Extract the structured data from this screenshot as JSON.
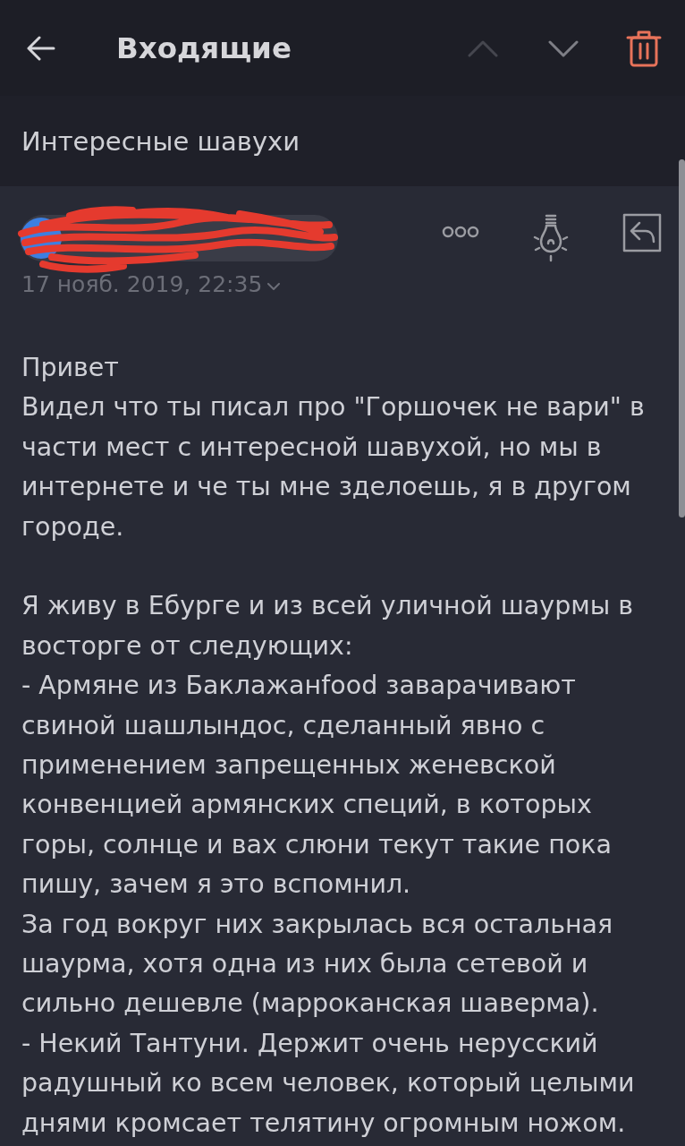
{
  "header": {
    "title": "Входящие",
    "nav": [
      {
        "kind": "up",
        "disabled": true
      },
      {
        "kind": "down",
        "disabled": false
      }
    ]
  },
  "subject": "Интересные шавухи",
  "message": {
    "date": "17 нояб. 2019, 22:35",
    "blocks": [
      {
        "lines": [
          "Привет",
          "Видел что ты писал про \"Горшочек не вари\" в части мест с интересной шавухой, но мы в интернете и че ты мне зделоешь, я в другом городе."
        ]
      },
      {
        "lines": [
          "Я живу в Ебурге и из всей уличной шаурмы в восторге от следующих:",
          "- Армяне из Баклажанfood заварачивают свиной шашлындос, сделанный явно с применением запрещенных женевской конвенцией армянских специй, в которых горы, солнце и вах слюни текут такие пока пишу, зачем я это вспомнил.",
          "За год вокруг них закрылась вся остальная шаурма, хотя одна из них была сетевой и сильно дешевле (марроканская шаверма).",
          "- Некий Тантуни. Держит очень нерусский радушный ко всем человек, который целыми днями кромсает телятину огромным ножом."
        ]
      }
    ]
  }
}
